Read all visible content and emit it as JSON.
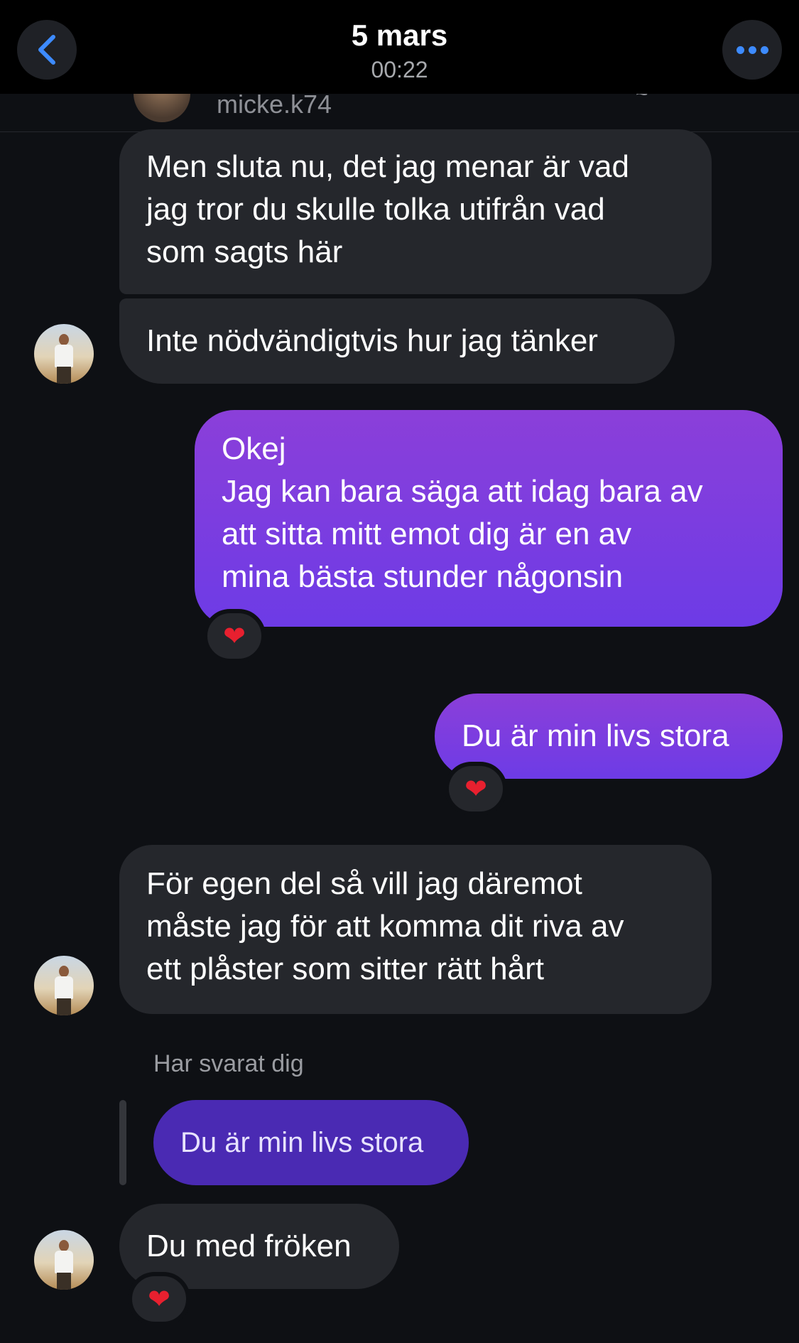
{
  "header": {
    "title": "5 mars",
    "time": "00:22"
  },
  "peek": {
    "username": "micke.k74",
    "trailing_mark": "~"
  },
  "messages": [
    {
      "side": "in",
      "lines": [
        "Men sluta nu, det jag menar är vad",
        "jag tror du skulle tolka utifrån vad",
        "som sagts här"
      ]
    },
    {
      "side": "in",
      "lines": [
        "Inte nödvändigtvis hur jag tänker"
      ]
    },
    {
      "side": "out",
      "lines": [
        "Okej",
        "Jag kan bara säga att idag bara av",
        "att sitta mitt emot dig är en av",
        "mina bästa stunder någonsin"
      ],
      "reaction": "❤"
    },
    {
      "side": "out",
      "lines": [
        "Du är min livs stora"
      ],
      "reaction": "❤"
    },
    {
      "side": "in",
      "lines": [
        "För egen del så vill jag däremot",
        "måste jag för att komma dit riva av",
        "ett plåster som sitter rätt hårt"
      ]
    },
    {
      "side": "in",
      "lines": [
        "Du med fröken"
      ],
      "reaction": "❤"
    }
  ],
  "reply": {
    "label": "Har svarat dig",
    "quoted_text": "Du är min livs stora"
  },
  "colors": {
    "background": "#0e1014",
    "incoming_bubble": "#25272c",
    "outgoing_gradient_top": "#8b3fd9",
    "outgoing_gradient_bottom": "#6d3be6",
    "accent": "#3d8bff",
    "reaction_heart": "#e8202f"
  },
  "icons": {
    "back": "chevron-left-icon",
    "more": "more-horizontal-icon",
    "reaction": "heart-icon"
  }
}
